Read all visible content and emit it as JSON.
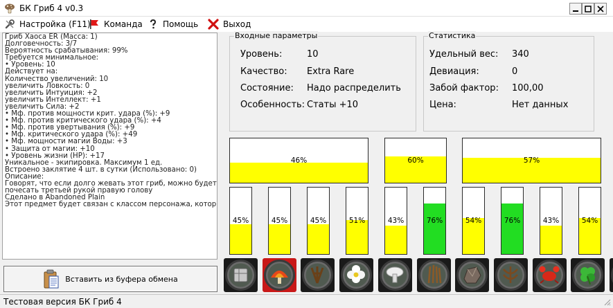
{
  "window": {
    "title": "БК Гриб 4 v0.3"
  },
  "menu": [
    {
      "label": "Настройка (F11)",
      "icon": "wrench-icon"
    },
    {
      "label": "Команда",
      "icon": "red-flag-icon"
    },
    {
      "label": "Помощь",
      "icon": "question-icon"
    },
    {
      "label": "Выход",
      "icon": "red-x-icon"
    }
  ],
  "item_info": [
    "Гриб Хаоса  ER   (Масса: 1)",
    "Долговечность: 3/7",
    "Вероятность срабатывания: 99%",
    "Требуется минимальное:",
    "• Уровень: 10",
    "Действует на:",
    "Количество увеличений: 10",
    "увеличить Ловкость: 0",
    "увеличить Интуиция: +2",
    "увеличить Интеллект: +1",
    "увеличить Сила: +2",
    "• Мф. против мощности крит. удара (%): +9",
    "• Мф. против критического удара (%): +4",
    "• Мф. против увертывания (%): +9",
    "• Мф. критического удара (%): +49",
    "• Мф. мощности магии Воды: +3",
    "• Защита от магии: +10",
    "• Уровень жизни (HP): +17",
    "Уникальное - экипировка. Максимум 1 ед.",
    "Встроено заклятие  4 шт. в сутки (Использовано: 0)",
    "Описание:",
    "Говорят, что если долго жевать этот гриб, можно будет",
    "почесать третьей рукой правую голову",
    "Сделано в Abandoned Plain",
    "Этот предмет будет связан с классом персонажа, который"
  ],
  "paste_button": {
    "label": "Вставить из буфера обмена",
    "icon": "clipboard-icon"
  },
  "input_params": {
    "title": "Входные параметры",
    "rows": [
      {
        "label": "Уровень:",
        "value": "10"
      },
      {
        "label": "Качество:",
        "value": "Extra Rare"
      },
      {
        "label": "Состояние:",
        "value": "Надо распределить"
      },
      {
        "label": "Особенность:",
        "value": "Статы +10"
      }
    ]
  },
  "statistics": {
    "title": "Статистика",
    "rows": [
      {
        "label": "Удельный вес:",
        "value": "340"
      },
      {
        "label": "Девиация:",
        "value": "0"
      },
      {
        "label": "Забой фактор:",
        "value": "100,00"
      },
      {
        "label": "Цена:",
        "value": "Нет данных"
      }
    ]
  },
  "summary_bars": [
    {
      "label": "46%",
      "value": 46,
      "color": "#ffff00"
    },
    {
      "label": "60%",
      "value": 60,
      "color": "#ffff00"
    },
    {
      "label": "57%",
      "value": 57,
      "color": "#ffff00"
    }
  ],
  "slot_bars": [
    {
      "label": "45%",
      "value": 45,
      "color": "#ffff00"
    },
    {
      "label": "45%",
      "value": 45,
      "color": "#ffff00"
    },
    {
      "label": "45%",
      "value": 45,
      "color": "#ffff00"
    },
    {
      "label": "51%",
      "value": 51,
      "color": "#ffff00"
    },
    {
      "label": "43%",
      "value": 43,
      "color": "#ffff00"
    },
    {
      "label": "76%",
      "value": 76,
      "color": "#22dd22"
    },
    {
      "label": "54%",
      "value": 54,
      "color": "#ffff00"
    },
    {
      "label": "76%",
      "value": 76,
      "color": "#22dd22"
    },
    {
      "label": "43%",
      "value": 43,
      "color": "#ffff00"
    },
    {
      "label": "54%",
      "value": 54,
      "color": "#ffff00"
    }
  ],
  "slots": [
    {
      "icon": "silver-crate-icon",
      "selected": false
    },
    {
      "icon": "red-orange-mushroom-icon",
      "selected": true
    },
    {
      "icon": "brown-roots-icon",
      "selected": false
    },
    {
      "icon": "white-flower-icon",
      "selected": false
    },
    {
      "icon": "white-mushroom-icon",
      "selected": false
    },
    {
      "icon": "brown-stalks-icon",
      "selected": false
    },
    {
      "icon": "rock-chunk-icon",
      "selected": false
    },
    {
      "icon": "brown-root-cluster-icon",
      "selected": false
    },
    {
      "icon": "red-crab-icon",
      "selected": false
    },
    {
      "icon": "green-clover-icon",
      "selected": false
    },
    {
      "icon": "red-berry-icon",
      "selected": false
    }
  ],
  "status": {
    "text": "Тестовая версия БК Гриб 4"
  }
}
